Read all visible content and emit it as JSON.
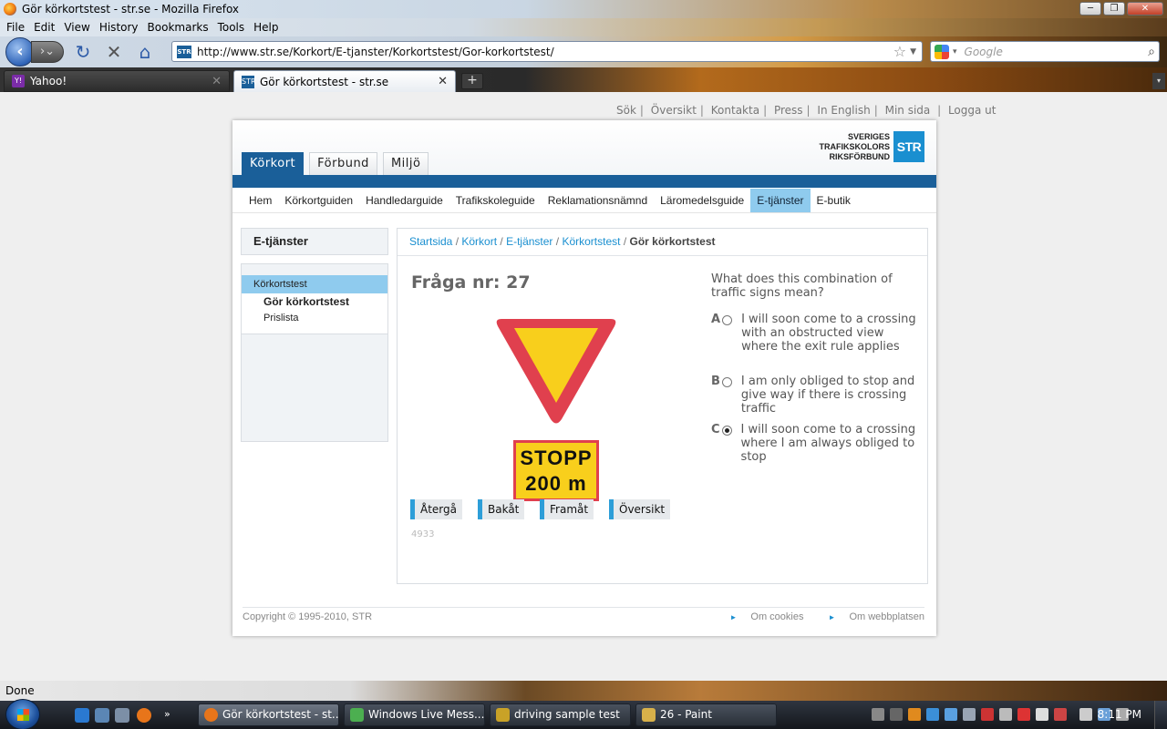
{
  "window": {
    "title": "Gör körkortstest - str.se - Mozilla Firefox",
    "buttons": {
      "minimize": "─",
      "maximize": "❐",
      "close": "✕"
    }
  },
  "menubar": [
    "File",
    "Edit",
    "View",
    "History",
    "Bookmarks",
    "Tools",
    "Help"
  ],
  "navbar": {
    "url": "http://www.str.se/Korkort/E-tjanster/Korkortstest/Gor-korkortstest/",
    "site_icon_label": "STR",
    "search_placeholder": "Google"
  },
  "tabs": [
    {
      "label": "Yahoo!",
      "favicon": "Y!"
    },
    {
      "label": "Gör körkortstest - str.se",
      "favicon": "STR"
    }
  ],
  "top_links": [
    "Sök",
    "Översikt",
    "Kontakta",
    "Press",
    "In English",
    "Min sida",
    "Logga ut"
  ],
  "site_tabs": [
    "Körkort",
    "Förbund",
    "Miljö"
  ],
  "logo": {
    "line1": "SVERIGES",
    "line2": "TRAFIKSKOLORS",
    "line3": "RIKSFÖRBUND",
    "box": "STR"
  },
  "subnav": [
    "Hem",
    "Körkortguiden",
    "Handledarguide",
    "Trafikskoleguide",
    "Reklamationsnämnd",
    "Läromedelsguide",
    "E-tjänster",
    "E-butik"
  ],
  "sidebar": {
    "heading": "E-tjänster",
    "items": [
      "Körkortstest",
      "Gör körkortstest",
      "Prislista"
    ]
  },
  "breadcrumb": {
    "links": [
      "Startsida",
      "Körkort",
      "E-tjänster",
      "Körkortstest"
    ],
    "current": "Gör körkortstest"
  },
  "question": {
    "title": "Fråga nr: 27",
    "text": "What does this combination of traffic signs mean?",
    "sign_text_1": "STOPP",
    "sign_text_2": "200 m",
    "answers": [
      {
        "letter": "A",
        "text": "I will soon come to a crossing with an obstructed view where the exit rule applies",
        "selected": false
      },
      {
        "letter": "B",
        "text": "I am only obliged to stop and give way if there is crossing traffic",
        "selected": false
      },
      {
        "letter": "C",
        "text": "I will soon come to a crossing where I am always obliged to stop",
        "selected": true
      }
    ],
    "buttons": [
      "Återgå",
      "Bakåt",
      "Framåt",
      "Översikt"
    ],
    "id": "4933"
  },
  "footer": {
    "copyright": "Copyright © 1995-2010, STR",
    "links": [
      "Om cookies",
      "Om webbplatsen"
    ]
  },
  "statusbar": {
    "text": "Done"
  },
  "taskbar": {
    "tasks": [
      "Gör körkortstest - st...",
      "Windows Live Mess...",
      "driving sample test",
      "26 - Paint"
    ],
    "clock": "8:11 PM"
  },
  "colors": {
    "brand_blue": "#1a5f99",
    "accent_light_blue": "#8fcbee",
    "link_blue": "#1a8fd0",
    "sign_red": "#e0404e",
    "sign_yellow": "#f8cf1c"
  }
}
